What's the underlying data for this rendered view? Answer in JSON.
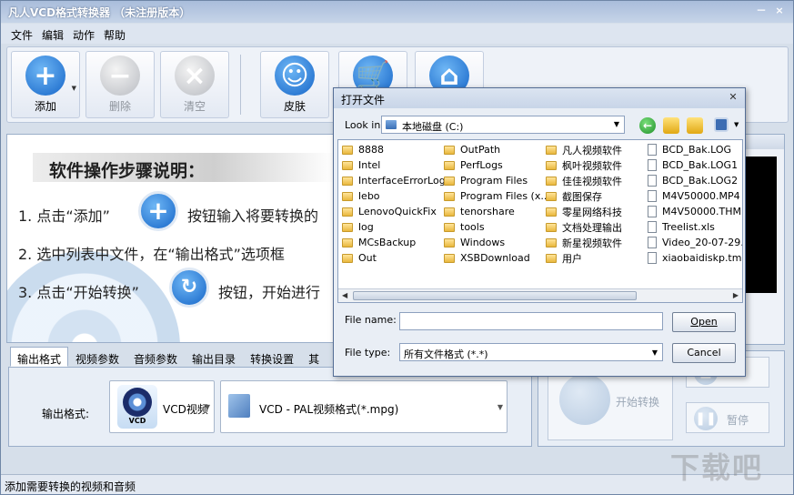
{
  "app": {
    "title": "凡人VCD格式转换器 （未注册版本）",
    "window_buttons": [
      "－",
      "×"
    ]
  },
  "menu": [
    "文件",
    "编辑",
    "动作",
    "帮助"
  ],
  "toolbar": {
    "add": "添加",
    "delete": "删除",
    "clear": "清空",
    "skin": "皮肤"
  },
  "guide": {
    "title": "软件操作步骤说明：",
    "step1_pre": "1. 点击“添加”",
    "step1_post": "按钮输入将要转换的",
    "step2": "2. 选中列表中文件，在“输出格式”选项框",
    "step3_pre": "3. 点击“开始转换”",
    "step3_post": "按钮，开始进行"
  },
  "tabs": [
    "输出格式",
    "视频参数",
    "音频参数",
    "输出目录",
    "转换设置",
    "其"
  ],
  "output": {
    "label": "输出格式:",
    "format1": "VCD视频",
    "format1_icon_text": "VCD",
    "format2": "VCD - PAL视频格式(*.mpg)"
  },
  "actions": {
    "start": "开始转换",
    "pause": "暂停"
  },
  "status": "添加需要转换的视频和音频",
  "watermark": "下载吧",
  "dialog": {
    "title": "打开文件",
    "look_in_label": "Look in:",
    "look_in_value": "本地磁盘 (C:)",
    "columns": [
      [
        {
          "name": "8888",
          "type": "folder"
        },
        {
          "name": "Intel",
          "type": "folder"
        },
        {
          "name": "InterfaceErrorLog",
          "type": "folder"
        },
        {
          "name": "lebo",
          "type": "folder"
        },
        {
          "name": "LenovoQuickFix",
          "type": "folder"
        },
        {
          "name": "log",
          "type": "folder"
        },
        {
          "name": "MCsBackup",
          "type": "folder"
        },
        {
          "name": "Out",
          "type": "folder"
        }
      ],
      [
        {
          "name": "OutPath",
          "type": "folder"
        },
        {
          "name": "PerfLogs",
          "type": "folder"
        },
        {
          "name": "Program Files",
          "type": "folder"
        },
        {
          "name": "Program Files (x...",
          "type": "folder"
        },
        {
          "name": "tenorshare",
          "type": "folder"
        },
        {
          "name": "tools",
          "type": "folder"
        },
        {
          "name": "Windows",
          "type": "folder"
        },
        {
          "name": "XSBDownload",
          "type": "folder"
        }
      ],
      [
        {
          "name": "凡人视频软件",
          "type": "folder"
        },
        {
          "name": "枫叶视频软件",
          "type": "folder"
        },
        {
          "name": "佳佳视频软件",
          "type": "folder"
        },
        {
          "name": "截图保存",
          "type": "folder"
        },
        {
          "name": "零星网络科技",
          "type": "folder"
        },
        {
          "name": "文档处理输出",
          "type": "folder"
        },
        {
          "name": "新星视频软件",
          "type": "folder"
        },
        {
          "name": "用户",
          "type": "folder"
        }
      ],
      [
        {
          "name": "BCD_Bak.LOG",
          "type": "file"
        },
        {
          "name": "BCD_Bak.LOG1",
          "type": "file"
        },
        {
          "name": "BCD_Bak.LOG2",
          "type": "file"
        },
        {
          "name": "M4V50000.MP4",
          "type": "file"
        },
        {
          "name": "M4V50000.THM",
          "type": "file"
        },
        {
          "name": "Treelist.xls",
          "type": "file"
        },
        {
          "name": "Video_20-07-29...",
          "type": "file"
        },
        {
          "name": "xiaobaidiskp.tmp",
          "type": "file"
        }
      ]
    ],
    "file_name_label": "File name:",
    "file_name_value": "",
    "file_type_label": "File type:",
    "file_type_value": "所有文件格式 (*.*)",
    "open": "Open",
    "cancel": "Cancel"
  }
}
